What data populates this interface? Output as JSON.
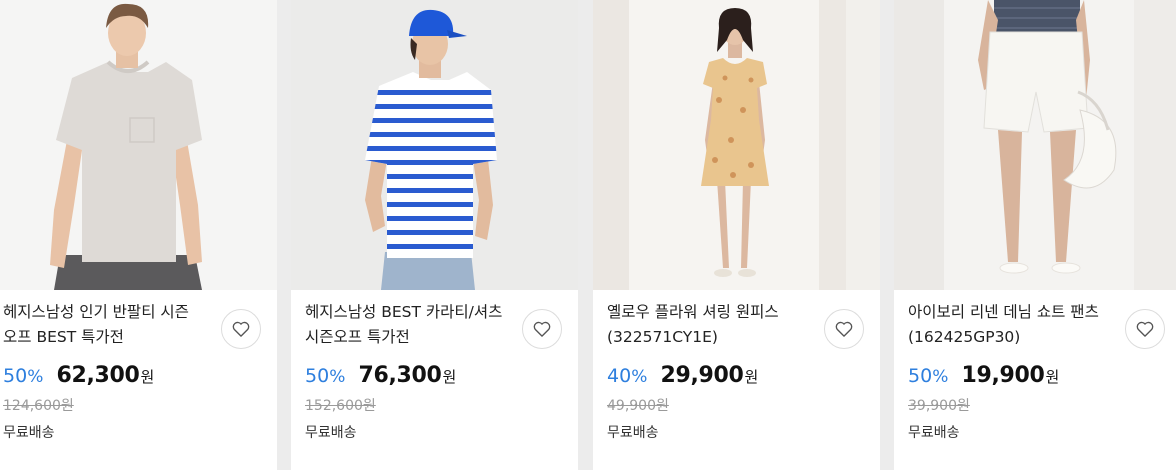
{
  "products": [
    {
      "name_line1": "헤지스남성 인기 반팔티 시즌",
      "name_line2": "오프 BEST 특가전",
      "discount_rate": "50",
      "percent_sign": "%",
      "price": "62,300",
      "currency": "원",
      "original_price": "124,600원",
      "shipping": "무료배송",
      "image": "model-gray-pocket-tshirt"
    },
    {
      "name_line1": "헤지스남성 BEST 카라티/셔츠",
      "name_line2": "시즌오프 특가전",
      "discount_rate": "50",
      "percent_sign": "%",
      "price": "76,300",
      "currency": "원",
      "original_price": "152,600원",
      "shipping": "무료배송",
      "image": "model-blue-stripe-tshirt"
    },
    {
      "name_line1": "옐로우 플라워 셔링 원피스",
      "name_line2": "(322571CY1E)",
      "discount_rate": "40",
      "percent_sign": "%",
      "price": "29,900",
      "currency": "원",
      "original_price": "49,900원",
      "shipping": "무료배송",
      "image": "model-yellow-floral-dress"
    },
    {
      "name_line1": "아이보리 리넨 데님 쇼트 팬츠",
      "name_line2": "(162425GP30)",
      "discount_rate": "50",
      "percent_sign": "%",
      "price": "19,900",
      "currency": "원",
      "original_price": "39,900원",
      "shipping": "무료배송",
      "image": "model-ivory-shorts"
    }
  ],
  "colors": {
    "discount": "#2e7fde",
    "price": "#111111",
    "original_price": "#9a9a9a",
    "background": "#ececec"
  },
  "icons": {
    "wishlist": "heart-outline-icon"
  }
}
